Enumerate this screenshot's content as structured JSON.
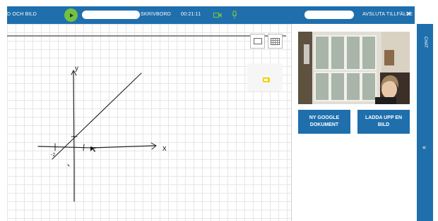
{
  "topbar": {
    "left_label": "D OCH BILD",
    "whiteboard_label": "SKRIVBORD",
    "timer": "00:21:11",
    "end_session_label": "AVSLUTA TILLFÄLLE",
    "close_glyph": "×"
  },
  "colors": {
    "bar": "#1f6fad",
    "play": "#74c043",
    "accent": "#74c043"
  },
  "whiteboard": {
    "drawing_labels": {
      "y_axis": "y",
      "x_axis": "x",
      "x_intercept": "-2"
    }
  },
  "panel": {
    "new_google_doc_label_line1": "NY GOOGLE",
    "new_google_doc_label_line2": "DOKUMENT",
    "upload_image_label_line1": "LADDA UPP EN",
    "upload_image_label_line2": "BILD"
  },
  "sidebar": {
    "chat_label": "CHAT",
    "collapse_glyph": "«"
  }
}
